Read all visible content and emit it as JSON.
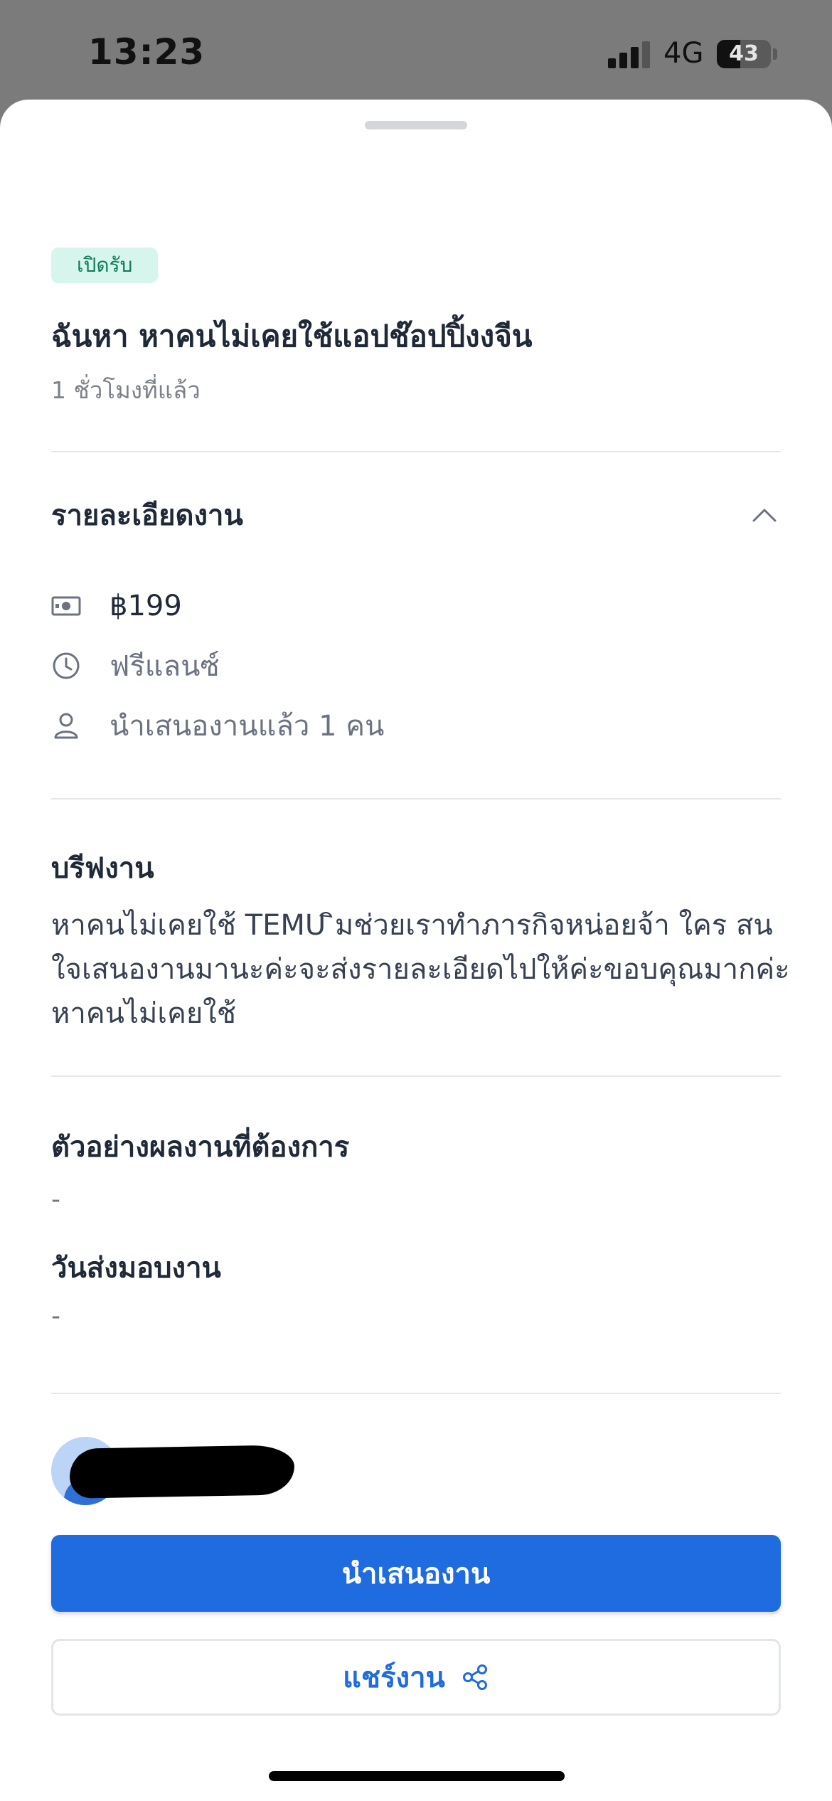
{
  "status_bar": {
    "time": "13:23",
    "network": "4G",
    "battery_percent": "43",
    "battery_level": 0.43
  },
  "job": {
    "status_badge": "เปิดรับ",
    "title": "ฉันหา หาคนไม่เคยใช้แอปช๊อปปิ้งงจีน",
    "posted": "1 ชั่วโมงที่แล้ว"
  },
  "details": {
    "header": "รายละเอียดงาน",
    "price": "฿199",
    "type": "ฟรีแลนซ์",
    "proposals": "นำเสนองานแล้ว 1 คน",
    "icons": {
      "price": "cash-icon",
      "type": "clock-icon",
      "proposals": "person-icon",
      "collapse": "chevron-up-icon"
    }
  },
  "brief": {
    "header": "บรีฟงาน",
    "text": "หาคนไม่เคยใช้ TEMU ิมช่วยเราทำภารกิจหน่อยจ้า ใคร สน ใจเสนองานมานะค่ะจะส่งรายละเอียดไปให้ค่ะขอบคุณมากค่ะหาคนไม่เคยใช้"
  },
  "sample": {
    "header": "ตัวอย่างผลงานที่ต้องการ",
    "value": "-"
  },
  "delivery": {
    "header": "วันส่งมอบงาน",
    "value": "-"
  },
  "actions": {
    "propose_label": "นำเสนองาน",
    "share_label": "แชร์งาน"
  },
  "colors": {
    "primary": "#1f6be0",
    "badge_bg": "#d6f5ec",
    "badge_text": "#0f7a5a"
  }
}
